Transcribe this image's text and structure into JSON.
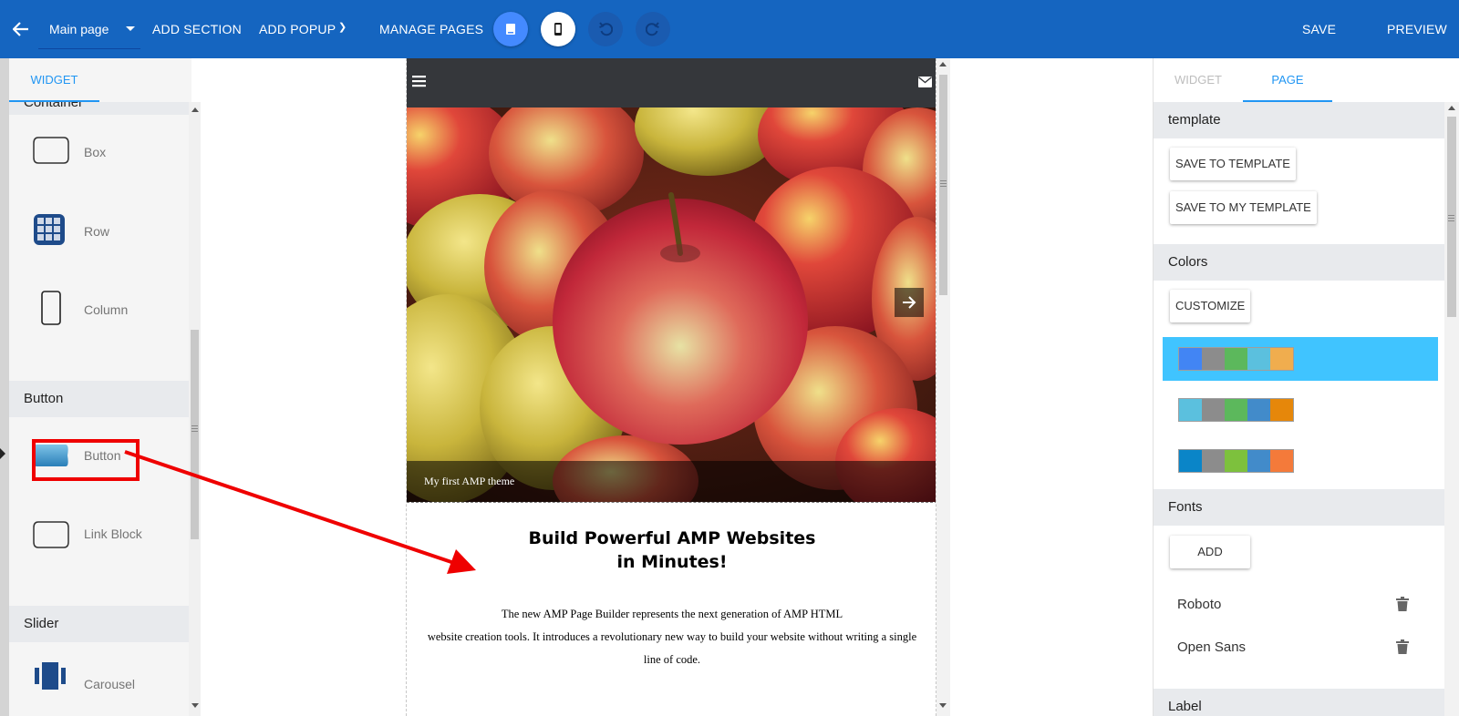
{
  "topbar": {
    "page_select": "Main page",
    "add_section": "ADD SECTION",
    "add_popup": "ADD POPUP",
    "manage_pages": "MANAGE PAGES",
    "save": "SAVE",
    "preview": "PREVIEW",
    "icons": [
      "back-arrow-icon",
      "desktop-icon",
      "mobile-icon",
      "undo-icon",
      "redo-icon"
    ]
  },
  "left_panel": {
    "tab": "WIDGET",
    "top_category": "Container",
    "items": [
      {
        "label": "Box",
        "icon": "box-icon"
      },
      {
        "label": "Row",
        "icon": "row-icon"
      },
      {
        "label": "Column",
        "icon": "column-icon"
      }
    ],
    "button_category": "Button",
    "button_items": [
      {
        "label": "Button",
        "icon": "button-icon"
      },
      {
        "label": "Link Block",
        "icon": "link-block-icon"
      }
    ],
    "slider_category": "Slider",
    "slider_items": [
      {
        "label": "Carousel",
        "icon": "carousel-icon"
      }
    ]
  },
  "canvas": {
    "slide_caption": "My first AMP theme",
    "headline_line1": "Build Powerful AMP Websites",
    "headline_line2": "in Minutes!",
    "body_line1": "The new AMP Page Builder represents the next generation of AMP HTML",
    "body_line2": "website creation tools. It introduces a revolutionary new way to build your website without writing a single",
    "body_line3": "line of code."
  },
  "right_panel": {
    "tab_widget": "WIDGET",
    "tab_page": "PAGE",
    "template_section": "template",
    "save_to_template": "SAVE TO TEMPLATE",
    "save_to_my_template": "SAVE TO MY TEMPLATE",
    "colors_section": "Colors",
    "customize": "CUSTOMIZE",
    "palettes": [
      [
        "#4285f4",
        "#8c8c8c",
        "#5cb85c",
        "#5bc0de",
        "#f0ad4e"
      ],
      [
        "#5bc0de",
        "#8c8c8c",
        "#5cb85c",
        "#428bca",
        "#e6870a"
      ],
      [
        "#0a85c8",
        "#8c8c8c",
        "#7dc13d",
        "#428bca",
        "#f47a3a"
      ]
    ],
    "selected_palette": 0,
    "fonts_section": "Fonts",
    "add_font": "ADD",
    "fonts": [
      "Roboto",
      "Open Sans"
    ],
    "label_section": "Label"
  },
  "colors": {
    "topbar": "#1565c0",
    "accent": "#2196f3",
    "selected_palette_bg": "#40c4ff",
    "annotation": "#ef0000"
  }
}
